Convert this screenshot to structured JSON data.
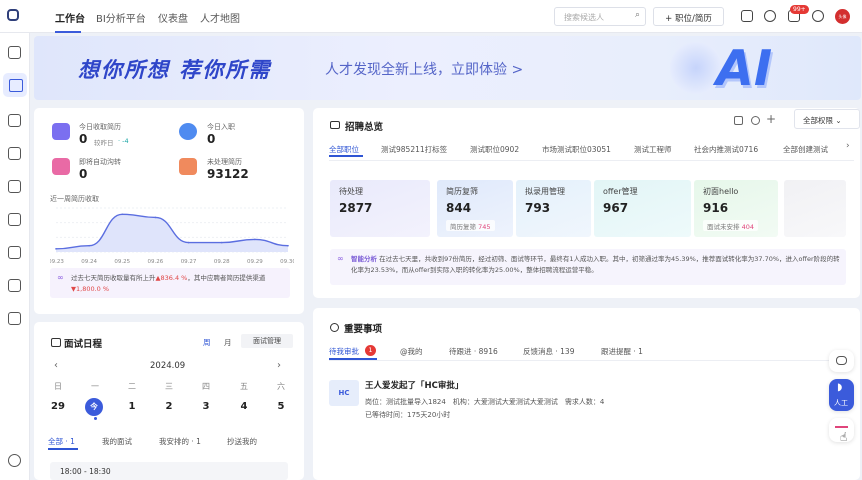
{
  "topnav": {
    "tabs": [
      "工作台",
      "BI分析平台",
      "仪表盘",
      "人才地图"
    ],
    "search_placeholder": "搜索候选人",
    "add_button": "+ 职位/简历",
    "notif_badge": "99+",
    "avatar_text": "头像"
  },
  "banner": {
    "title": "想你所想 荐你所需",
    "subtitle": "人才发现全新上线，立即体验 >",
    "ai_text": "AI"
  },
  "left_stats": {
    "items": [
      {
        "label": "今日收取简历",
        "value": "0",
        "sub": "较昨日",
        "sub_delta": "· -4"
      },
      {
        "label": "今日入职",
        "value": "0"
      },
      {
        "label": "即将自动沟转",
        "value": "0"
      },
      {
        "label": "未处理简历",
        "value": "93122"
      }
    ],
    "chart_title": "近一周简历收取",
    "insight_prefix": "过去七天简历收取量有所上升",
    "insight_up": "▲836.4 %",
    "insight_mid": "，其中应聘者简历提供",
    "insight_tail": "渠道",
    "insight_down": "▼1,800.0 %"
  },
  "chart_data": {
    "type": "area",
    "categories": [
      "09.23",
      "09.24",
      "09.25",
      "09.26",
      "09.27",
      "09.28",
      "09.29",
      "09.30"
    ],
    "series": [
      {
        "values": [
          1,
          2,
          12,
          11,
          3,
          3,
          4,
          2
        ]
      }
    ],
    "ylim": [
      0,
      14
    ],
    "grid": true
  },
  "overview": {
    "title": "招聘总览",
    "permission": "全部权限",
    "tabs": [
      "全部职位",
      "测试985211打标签",
      "测试职位0902",
      "市场测试职位03051",
      "测试工程师",
      "社会内推测试0716",
      "全部创建测试"
    ],
    "stats": [
      {
        "label": "待处理",
        "value": "2877"
      },
      {
        "label": "简历复筛",
        "value": "844",
        "sub": "简历复筛",
        "sub_num": "745"
      },
      {
        "label": "拟录用管理",
        "value": "793"
      },
      {
        "label": "offer管理",
        "value": "967"
      },
      {
        "label": "初面hello",
        "value": "916",
        "sub": "面试未安排",
        "sub_num": "404"
      }
    ],
    "analysis_label": "智能分析",
    "analysis_text": "在过去七天里，共收到97份简历，经过初筛、面试等环节，最终有1人成功入职。其中，初筛通过率为45.39%，推荐面试转化率为37.70%，进入offer阶段的转化率为23.53%，而从offer到实际入职的转化率为25.00%，整体招聘流程运营平稳。"
  },
  "schedule": {
    "title": "面试日程",
    "view_week": "周",
    "view_month": "月",
    "manage": "面试管理",
    "month": "2024.09",
    "weekdays": [
      "日",
      "一",
      "二",
      "三",
      "四",
      "五",
      "六"
    ],
    "dates": [
      "29",
      "今",
      "1",
      "2",
      "3",
      "4",
      "5"
    ],
    "tabs": [
      "全部 · 1",
      "我的面试",
      "我安排的 · 1",
      "抄送我的"
    ],
    "time": "18:00 - 18:30"
  },
  "todos": {
    "title": "重要事项",
    "tabs": [
      "待我审批",
      "@我的",
      "待跟进 · 8916",
      "反馈消息 · 139",
      "跟进提醒 · 1"
    ],
    "approve_badge": "1",
    "item_title": "王人爱发起了「HC审批」",
    "item_line1": "岗位：测试批量导入1824　机构：大爱测试大爱测试大爱测试　需求人数：4",
    "item_line2": "已等待时间：175天20小时",
    "item_icon_text": "HC"
  },
  "float": {
    "human_label": "人工"
  }
}
